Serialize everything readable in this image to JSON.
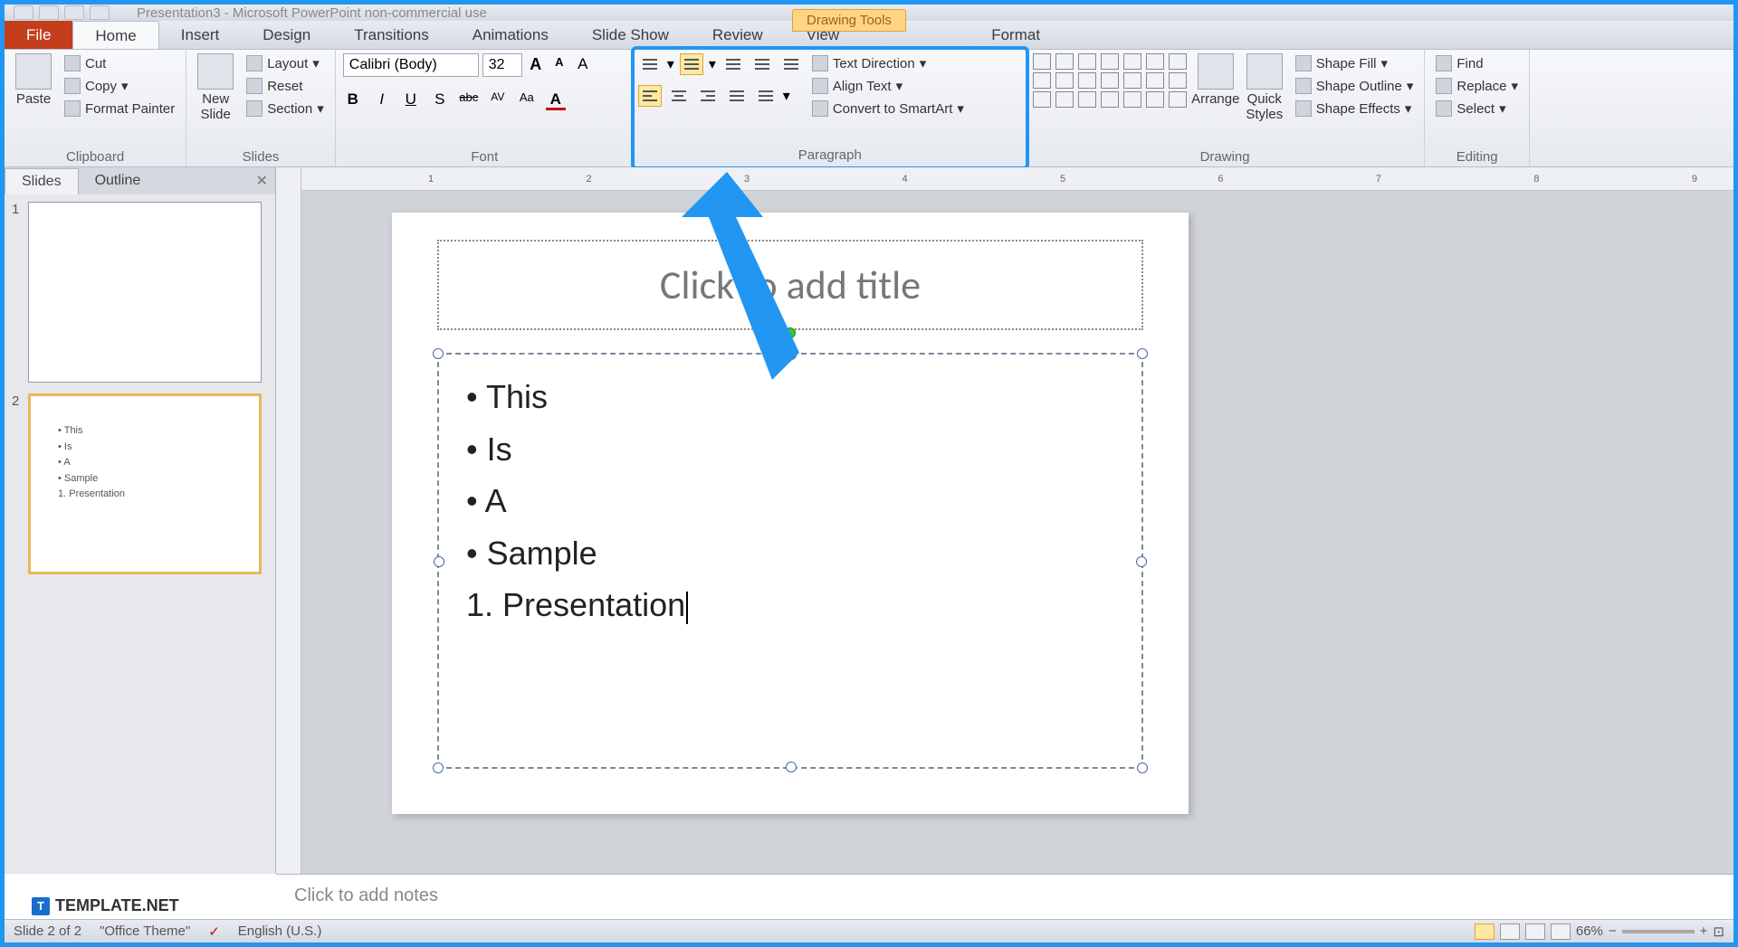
{
  "window": {
    "title": "Presentation3 - Microsoft PowerPoint non-commercial use"
  },
  "context_tab": "Drawing Tools",
  "tabs": {
    "file": "File",
    "home": "Home",
    "insert": "Insert",
    "design": "Design",
    "transitions": "Transitions",
    "animations": "Animations",
    "slideshow": "Slide Show",
    "review": "Review",
    "view": "View",
    "format": "Format"
  },
  "ribbon": {
    "clipboard": {
      "label": "Clipboard",
      "paste": "Paste",
      "cut": "Cut",
      "copy": "Copy",
      "format_painter": "Format Painter"
    },
    "slides": {
      "label": "Slides",
      "new_slide": "New\nSlide",
      "layout": "Layout",
      "reset": "Reset",
      "section": "Section"
    },
    "font": {
      "label": "Font",
      "name": "Calibri (Body)",
      "size": "32",
      "bold": "B",
      "italic": "I",
      "underline": "U",
      "strike": "S",
      "abc": "abc",
      "av": "AV",
      "aa": "Aa",
      "grow": "A",
      "shrink": "A",
      "clear": "Aₓ",
      "color": "A"
    },
    "paragraph": {
      "label": "Paragraph",
      "text_direction": "Text Direction",
      "align_text": "Align Text",
      "convert_smartart": "Convert to SmartArt"
    },
    "drawing": {
      "label": "Drawing",
      "arrange": "Arrange",
      "quick_styles": "Quick\nStyles",
      "fill": "Shape Fill",
      "outline": "Shape Outline",
      "effects": "Shape Effects"
    },
    "editing": {
      "label": "Editing",
      "find": "Find",
      "replace": "Replace",
      "select": "Select"
    }
  },
  "pane": {
    "slides": "Slides",
    "outline": "Outline"
  },
  "thumbnails": [
    {
      "num": "1",
      "items": []
    },
    {
      "num": "2",
      "items": [
        "This",
        "Is",
        "A",
        "Sample"
      ],
      "num_item": "Presentation"
    }
  ],
  "slide": {
    "title_placeholder": "Click to add title",
    "bullets": [
      "This",
      "Is",
      "A",
      "Sample"
    ],
    "numbered": [
      "Presentation"
    ]
  },
  "notes": {
    "placeholder": "Click to add notes"
  },
  "status": {
    "slide_info": "Slide 2 of 2",
    "theme": "\"Office Theme\"",
    "lang": "English (U.S.)",
    "zoom": "66%"
  },
  "branding": {
    "text": "TEMPLATE.NET",
    "icon": "T"
  }
}
